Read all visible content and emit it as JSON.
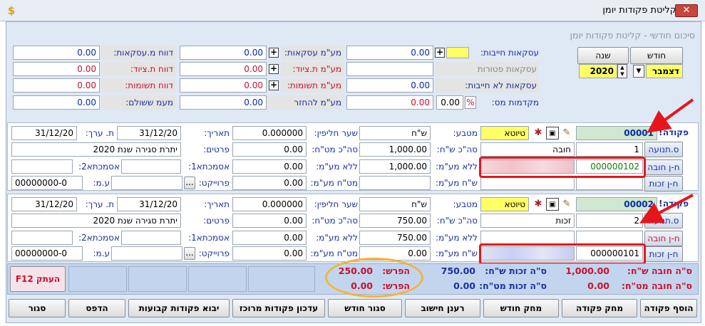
{
  "window": {
    "title": "קליטת פקודות יומן",
    "close_label": "✕",
    "app_icon": "$"
  },
  "subtitle": "סיכום חודשי - קליטת פקודות יומן",
  "period": {
    "month_label": "חודש",
    "year_label": "שנה",
    "month": "דצמבר",
    "year": "2020"
  },
  "summary": {
    "taxable_label": "עסקאות חייבות:",
    "taxable_value": "0.00",
    "exempt_label": "עסקאות פטורות",
    "nontaxable_label": "עסקאות לא חייבות:",
    "nontaxable_value": "0.00",
    "advance_label": "מקדמות מס:",
    "advance_value": "0.00",
    "advance_pct": "0.00",
    "pct_sign": "%",
    "vat_sales_label": "מע\"מ עסקאות:",
    "vat_sales_value": "0.00",
    "vat_eq_label": "מע\"מ ת.ציוד:",
    "vat_eq_value": "0.00",
    "vat_pay_label": "מע\"מ תשומות:",
    "vat_pay_value": "0.00",
    "vat_refund_label": "מע\"מ להחזר",
    "vat_refund_value": "0.00",
    "rep_sales_label": "דווח מ.עסקאות:",
    "rep_sales_value": "0.00",
    "rep_eq_label": "דווח ת.ציוד:",
    "rep_eq_value": "0.00",
    "rep_pay_label": "דווח תשומות:",
    "rep_pay_value": "0.00",
    "vat_paid_label": "מעמ ששולם:",
    "vat_paid_value": "0.00"
  },
  "entries": [
    {
      "order_label": "פקודה",
      "order_no": "00001",
      "draft": "טיוטא",
      "currency_label": "מטבע:",
      "currency": "ש\"ח",
      "rate_label": "שער חליפין:",
      "rate": "0.000000",
      "date_label": "תאריך:",
      "date": "31/12/20",
      "value_date_label": "ת. ערך:",
      "value_date": "31/12/20",
      "move_btn": "ס.תנועה",
      "move_no": "1",
      "move_type": "חובה",
      "total_label": "סה\"כ ש\"ח:",
      "total": "1,000.00",
      "total_vat_label": "סה\"כ מט\"ח:",
      "total_vat": "0.00",
      "details_label": "פרטים:",
      "details": "יתרת סגירה שנת 2020",
      "debit_btn": "ח-ן חובה",
      "debit_acc": "000000102",
      "novat_label": "ללא מע\"מ:",
      "novat": "1,000.00",
      "novat_fx_label": "ללא מע\"מ:",
      "novat_fx": "0.00",
      "ref1_label": "אסמכתא1:",
      "ref2_label": "אסמכתא2:",
      "credit_btn": "ח-ן זכות",
      "credit_acc": "",
      "vat_sh_label": "ש\"ח מע\"מ:",
      "vat_sh": "",
      "vat_fx_label": "מט\"ח מע\"מ:",
      "vat_fx": "0.00",
      "project_label": "פרוייקט:",
      "project_btn": "...",
      "um_label": "ע.מ:",
      "um": "00000000-0"
    },
    {
      "order_label": "פקודה",
      "order_no": "00002",
      "draft": "טיוטא",
      "currency_label": "מטבע:",
      "currency": "ש\"ח",
      "rate_label": "שער חליפין:",
      "rate": "0.000000",
      "date_label": "תאריך:",
      "date": "31/12/20",
      "value_date_label": "ת. ערך:",
      "value_date": "31/12/20",
      "move_btn": "ס.תנועה",
      "move_no": "2",
      "move_type": "זכות",
      "total_label": "סה\"כ ש\"ח:",
      "total": "750.00",
      "total_vat_label": "סה\"כ מט\"ח:",
      "total_vat": "0.00",
      "details_label": "פרטים:",
      "details": "יתרת סגירה שנת 2020",
      "debit_btn": "ח-ן חובה",
      "debit_acc": "",
      "novat_label": "ללא מע\"מ:",
      "novat": "750.00",
      "novat_fx_label": "ללא מע\"מ:",
      "novat_fx": "0.00",
      "ref1_label": "אסמכתא1:",
      "ref2_label": "אסמכתא2:",
      "credit_btn": "ח-ן זכות",
      "credit_acc": "000000101",
      "vat_sh_label": "ש\"ח מע\"מ:",
      "vat_sh": "0.00",
      "vat_fx_label": "מט\"ח מע\"מ:",
      "vat_fx": "0.00",
      "project_label": "פרוייקט:",
      "project_btn": "...",
      "um_label": "ע.מ:",
      "um": "00000000-0"
    }
  ],
  "totals": {
    "debit_sh_label": "ס\"ה חובה ש\"ח:",
    "debit_sh": "1,000.00",
    "debit_fx_label": "ס\"ה חובה מט\"ח:",
    "debit_fx": "0.00",
    "credit_sh_label": "ס\"ה זכות ש\"ח:",
    "credit_sh": "750.00",
    "credit_fx_label": "ס\"ה זכות מט\"ח:",
    "credit_fx": "0.00",
    "diff_label": "הפרש:",
    "diff_sh": "250.00",
    "diff_fx": "0.00",
    "copy_btn": "העתק F12"
  },
  "buttons": [
    "הוסף פקודה",
    "מחק פקודה",
    "מחק חודש",
    "רענן חישוב",
    "סגור חודש",
    "עדכון פקודות מרוכז",
    "יבוא פקודות קבועות",
    "הדפס",
    "סגור"
  ],
  "colors": {
    "accent_red": "#e8141b",
    "highlight_orange": "#f3b43a",
    "label_blue": "#1a2fa0",
    "warning_red": "#c8102e"
  }
}
